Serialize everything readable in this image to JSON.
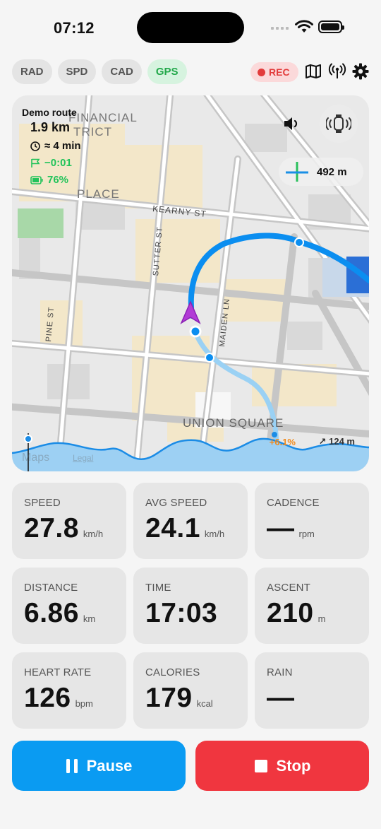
{
  "status_bar": {
    "time": "07:12"
  },
  "sensors": [
    "RAD",
    "SPD",
    "CAD",
    "GPS"
  ],
  "active_sensor": "GPS",
  "recording": {
    "label": "REC"
  },
  "map": {
    "route_name": "Demo route",
    "remaining_distance": "1.9 km",
    "eta": "≈ 4 min",
    "time_delta": "−0:01",
    "battery": "76%",
    "scale": "492 m",
    "streets": [
      "FINANCIAL",
      "TRICT",
      "PLACE",
      "KEARNY ST",
      "SUTTER ST",
      "MAIDEN LN",
      "PINE ST",
      "UNION SQUARE"
    ],
    "elevation": {
      "grade": "+6.1%",
      "altitude": "↗ 124 m"
    },
    "attribution": {
      "logo": "Maps",
      "legal": "Legal"
    }
  },
  "tiles": [
    {
      "label": "SPEED",
      "value": "27.8",
      "unit": "km/h"
    },
    {
      "label": "AVG SPEED",
      "value": "24.1",
      "unit": "km/h"
    },
    {
      "label": "CADENCE",
      "value": "—",
      "unit": "rpm"
    },
    {
      "label": "DISTANCE",
      "value": "6.86",
      "unit": "km"
    },
    {
      "label": "TIME",
      "value": "17:03",
      "unit": ""
    },
    {
      "label": "ASCENT",
      "value": "210",
      "unit": "m"
    },
    {
      "label": "HEART RATE",
      "value": "126",
      "unit": "bpm"
    },
    {
      "label": "CALORIES",
      "value": "179",
      "unit": "kcal"
    },
    {
      "label": "RAIN",
      "value": "—",
      "unit": ""
    }
  ],
  "actions": {
    "pause": "Pause",
    "stop": "Stop"
  },
  "colors": {
    "accent": "#0a9bf2",
    "danger": "#f0363f",
    "positive": "#22c35a",
    "gps_active": "#22a84a"
  }
}
